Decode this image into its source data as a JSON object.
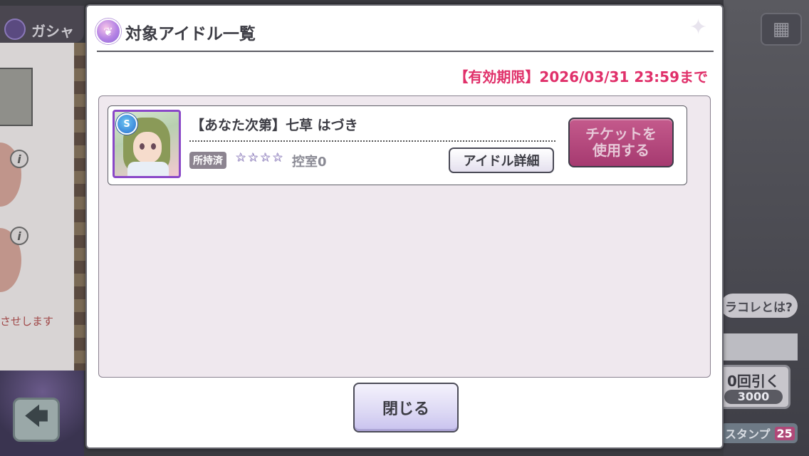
{
  "background": {
    "gacha_label": "ガシャ",
    "info_glyph": "i",
    "red_note": "させします",
    "back_glyph": "🡄",
    "grid_glyph": "▦",
    "rakore_label": "ラコレとは?",
    "pull_label": "0回引く",
    "pull_cost": "3000",
    "stamp_label": "スタンプ",
    "stamp_count": "25"
  },
  "dialog": {
    "title": "対象アイドル一覧",
    "sparkle_glyph": "✦",
    "deadline": "【有効期限】2026/03/31 23:59まで",
    "close_label": "閉じる"
  },
  "idol": {
    "rarity": "S",
    "name": "【あなた次第】七草 はづき",
    "owned_tag": "所持済",
    "stars": [
      "☆",
      "☆",
      "☆",
      "☆"
    ],
    "reserve": "控室0",
    "detail_label": "アイドル詳細",
    "use_label_line1": "チケットを",
    "use_label_line2": "使用する"
  },
  "colors": {
    "deadline": "#e0306a",
    "use_button": "#b04a7e",
    "rarity_badge": "#2a6ed0",
    "portrait_frame": "#8a48c8"
  }
}
